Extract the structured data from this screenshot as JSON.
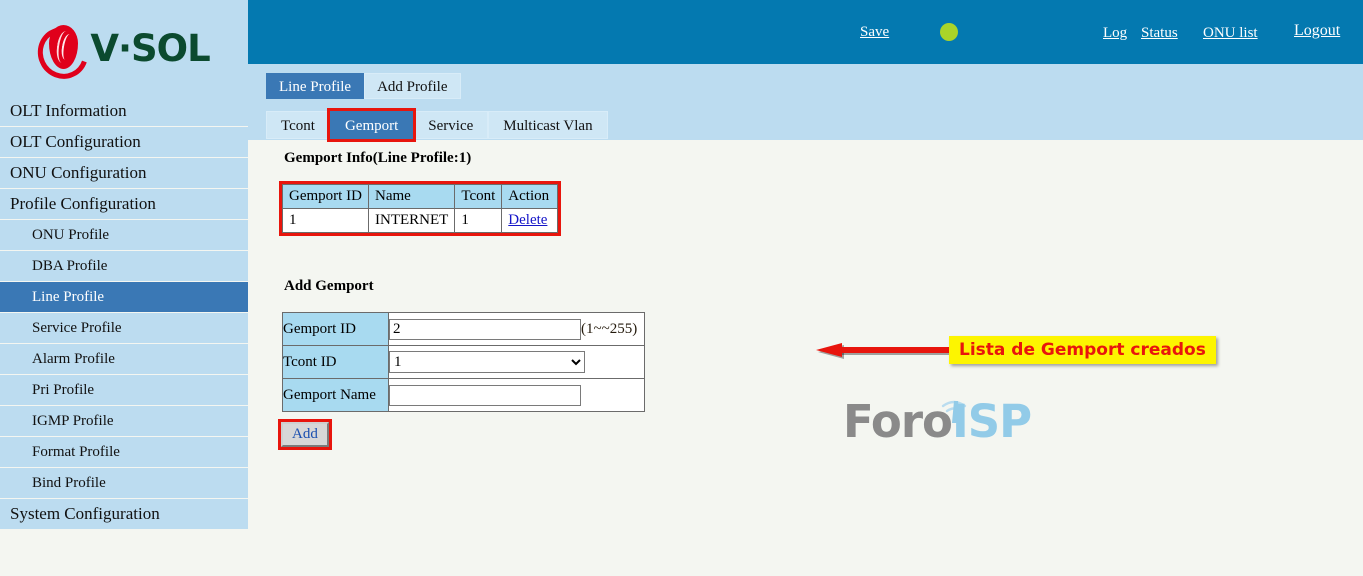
{
  "brand": {
    "logo_text_v": "V",
    "logo_text_dot": "·",
    "logo_text_sol": "SOL",
    "logo_full": "V·SOL",
    "accent_red": "#e0001b",
    "accent_green": "#0b4a2f"
  },
  "header": {
    "background": "#0479b0",
    "save_label": "Save",
    "status_led_color": "#aad429",
    "log_label": "Log",
    "status_label": "Status",
    "onu_list_label": "ONU list",
    "logout_label": "Logout"
  },
  "sidebar": {
    "background": "#bcdcf0",
    "selected_color": "#3a78b5",
    "items": [
      {
        "label": "OLT Information",
        "level": "top",
        "selected": false
      },
      {
        "label": "OLT Configuration",
        "level": "top",
        "selected": false
      },
      {
        "label": "ONU Configuration",
        "level": "top",
        "selected": false
      },
      {
        "label": "Profile Configuration",
        "level": "top",
        "selected": false
      },
      {
        "label": "ONU Profile",
        "level": "sub",
        "selected": false
      },
      {
        "label": "DBA Profile",
        "level": "sub",
        "selected": false
      },
      {
        "label": "Line Profile",
        "level": "sub",
        "selected": true
      },
      {
        "label": "Service Profile",
        "level": "sub",
        "selected": false
      },
      {
        "label": "Alarm Profile",
        "level": "sub",
        "selected": false
      },
      {
        "label": "Pri Profile",
        "level": "sub",
        "selected": false
      },
      {
        "label": "IGMP Profile",
        "level": "sub",
        "selected": false
      },
      {
        "label": "Format Profile",
        "level": "sub",
        "selected": false
      },
      {
        "label": "Bind Profile",
        "level": "sub",
        "selected": false
      },
      {
        "label": "System Configuration",
        "level": "top",
        "selected": false
      }
    ]
  },
  "tabs_primary": [
    {
      "label": "Line Profile",
      "active": true
    },
    {
      "label": "Add Profile",
      "active": false
    }
  ],
  "tabs_secondary": [
    {
      "label": "Tcont",
      "active": false,
      "highlighted": false
    },
    {
      "label": "Gemport",
      "active": true,
      "highlighted": true
    },
    {
      "label": "Service",
      "active": false,
      "highlighted": false
    },
    {
      "label": "Multicast Vlan",
      "active": false,
      "highlighted": false
    }
  ],
  "info_section": {
    "title": "Gemport Info(Line Profile:1)",
    "columns": [
      "Gemport ID",
      "Name",
      "Tcont",
      "Action"
    ],
    "rows": [
      {
        "gemport_id": "1",
        "name": "INTERNET",
        "tcont": "1",
        "action": "Delete"
      }
    ]
  },
  "annotation": {
    "text": "Lista de Gemport creados",
    "text_color": "#e8150d",
    "background": "#fdf500",
    "arrow_color": "#e8150d"
  },
  "watermark": {
    "text_1": "Foro",
    "text_2": "ISP",
    "color_1": "#8a8a8a",
    "color_2": "#92cbe8"
  },
  "add_form": {
    "title": "Add Gemport",
    "gemport_id_label": "Gemport ID",
    "gemport_id_value": "2",
    "gemport_id_hint": "(1~~255)",
    "tcont_id_label": "Tcont ID",
    "tcont_id_value": "1",
    "tcont_id_options": [
      "1"
    ],
    "gemport_name_label": "Gemport Name",
    "gemport_name_value": "",
    "add_button_label": "Add"
  }
}
